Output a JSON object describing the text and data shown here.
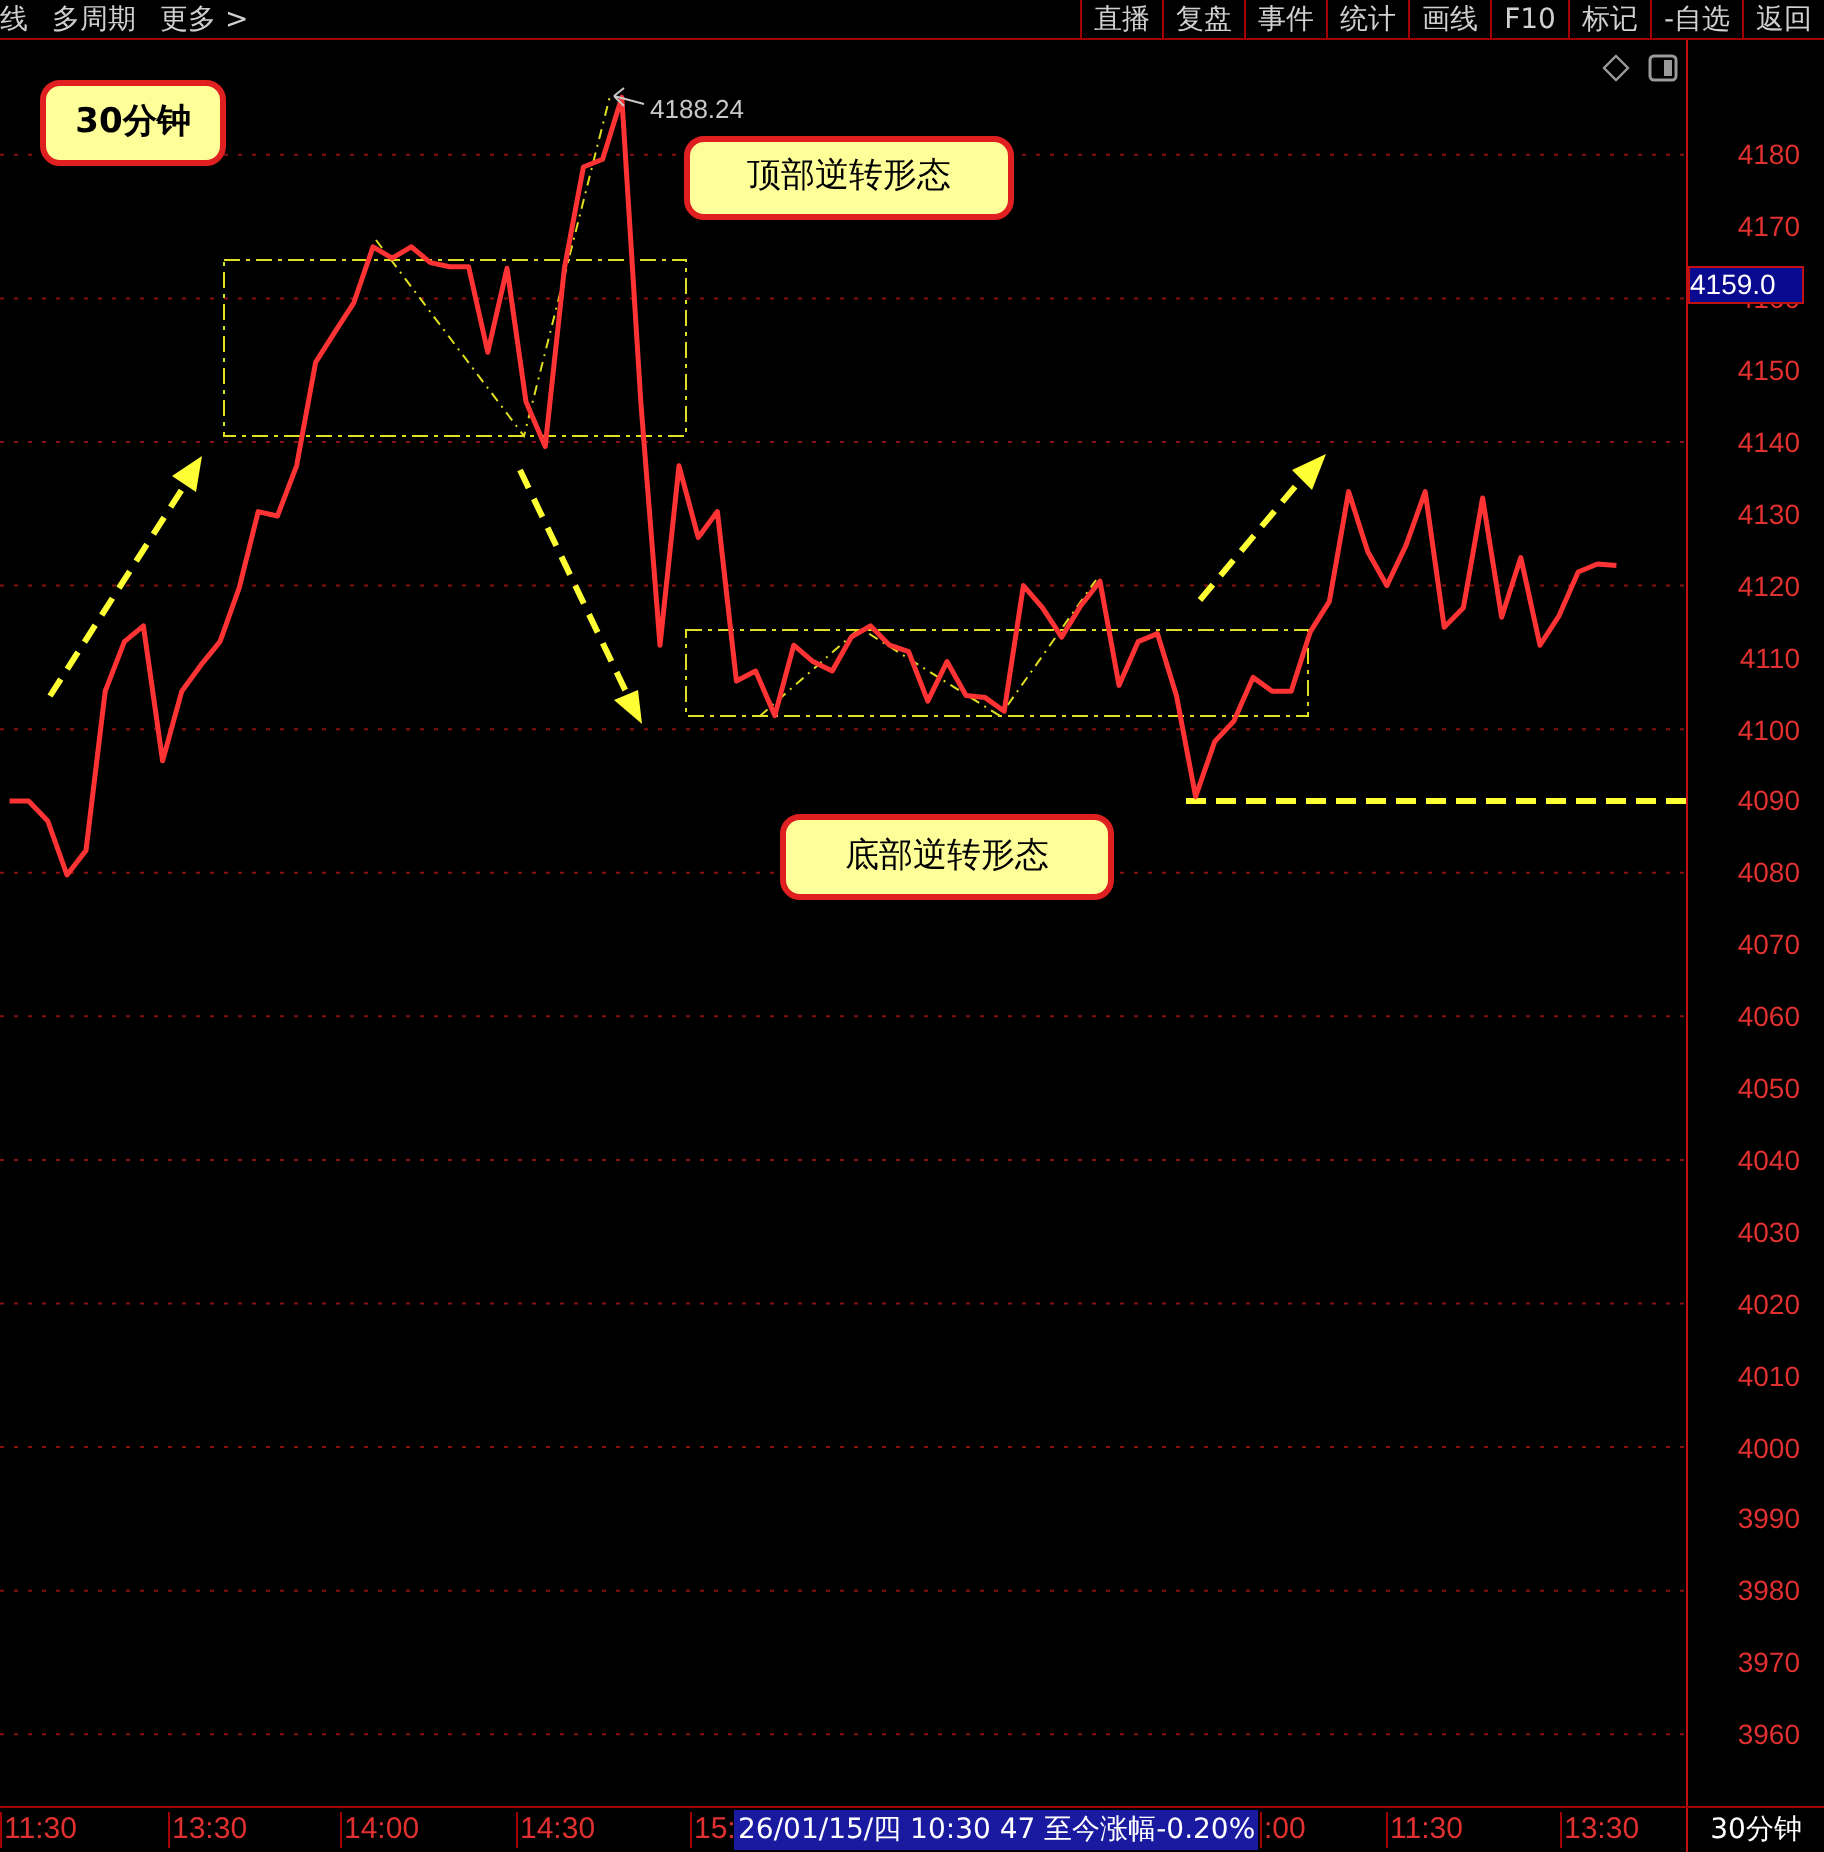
{
  "top_bar": {
    "left_items": [
      "线",
      "多周期",
      "更多 >"
    ],
    "buttons": [
      "直播",
      "复盘",
      "事件",
      "统计",
      "画线",
      "F10",
      "标记",
      "-自选",
      "返回"
    ]
  },
  "chart": {
    "current_price": "4159.0",
    "chart_data": {
      "type": "line",
      "grid": true,
      "ylim": [
        3950,
        4196
      ],
      "ref_lines": [
        {
          "axis": "y",
          "value": 4090,
          "color": "#ffff33"
        }
      ],
      "yticks": [
        3960,
        3970,
        3980,
        3990,
        4000,
        4010,
        4020,
        4030,
        4040,
        4050,
        4060,
        4070,
        4080,
        4090,
        4100,
        4110,
        4120,
        4130,
        4140,
        4150,
        4160,
        4170,
        4180
      ],
      "series": [
        {
          "color": "#ff3333",
          "values": [
            4090,
            4090,
            4087.2,
            4079.7,
            4083.1,
            4105.3,
            4112.2,
            4114.4,
            4095.6,
            4105.3,
            4108.9,
            4112.2,
            4119.7,
            4130.3,
            4129.7,
            4136.7,
            4151.1,
            4155.3,
            4159.4,
            4167.2,
            4165.6,
            4167.2,
            4165,
            4164.4,
            4164.4,
            4152.5,
            4164.2,
            4145.6,
            4139.4,
            4164.2,
            4178.3,
            4179.4,
            4188,
            4145.6,
            4111.7,
            4136.7,
            4126.7,
            4130.3,
            4106.7,
            4108.1,
            4101.9,
            4111.7,
            4109.4,
            4108.1,
            4112.8,
            4114.4,
            4111.7,
            4110.8,
            4103.9,
            4109.4,
            4104.7,
            4104.4,
            4102.5,
            4120,
            4116.9,
            4112.8,
            4117.2,
            4120.6,
            4106.1,
            4112.2,
            4113.3,
            4104.7,
            4090.6,
            4098.3,
            4101.1,
            4107.2,
            4105.3,
            4105.3,
            4113.6,
            4117.8,
            4133.1,
            4124.7,
            4120,
            4125.6,
            4133.1,
            4114.2,
            4116.9,
            4132.2,
            4115.6,
            4123.9,
            4111.7,
            4115.8,
            4121.9,
            4123,
            4122.8
          ]
        }
      ],
      "annotations": [
        {
          "text": "4188.24"
        },
        {
          "text": "30分钟"
        },
        {
          "text": "顶部逆转形态"
        },
        {
          "text": "底部逆转形态"
        }
      ]
    }
  },
  "time_axis": {
    "labels": [
      "11:30",
      "13:30",
      "14:00",
      "14:30",
      "15:",
      ":00",
      "11:30",
      "13:30"
    ],
    "info": "26/01/15/四 10:30 47 至今涨幅-0.20%",
    "period": "30分钟"
  }
}
